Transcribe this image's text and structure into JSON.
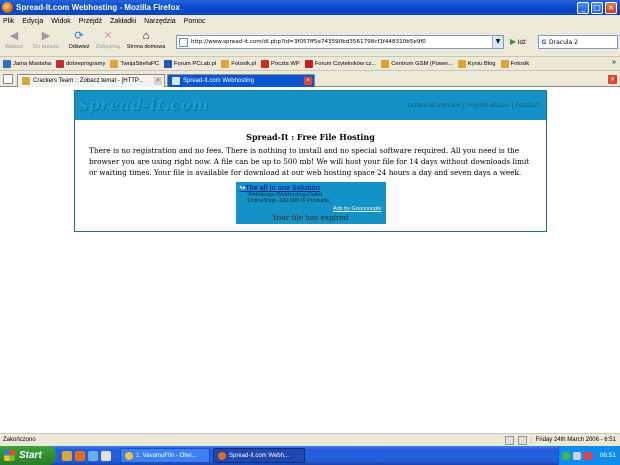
{
  "window": {
    "title": "Spread-It.com Webhosting - Mozilla Firefox",
    "minimize": "_",
    "maximize": "□",
    "close": "×"
  },
  "menu": [
    "Plik",
    "Edycja",
    "Widok",
    "Przejdź",
    "Zakładki",
    "Narzędzia",
    "Pomoc"
  ],
  "toolbar": {
    "back": "Wstecz",
    "forward": "Do przodu",
    "reload": "Odśwież",
    "stop": "Zatrzymaj",
    "home": "Strona domowa",
    "url": "http://www.spread-it.com/dl.php?id=3f057ff5e743590bd3561798cf1f448310b5e9f0",
    "go": "Idź",
    "search_value": "Dracula 2"
  },
  "bookmarks": [
    {
      "label": "Jama Mastaha",
      "color": "#3a6fc0"
    },
    {
      "label": "dobreprogramy",
      "color": "#c0302a"
    },
    {
      "label": "TwojaStrefaPC",
      "color": "#d9a64a"
    },
    {
      "label": "Forum PCLab.pl",
      "color": "#2457b0"
    },
    {
      "label": "Fotosik.pl",
      "color": "#d8a93a"
    },
    {
      "label": "Poczta WP",
      "color": "#d0281c"
    },
    {
      "label": "Forum Czytelników cz...",
      "color": "#c42020"
    },
    {
      "label": "Centrum GSM (Power...",
      "color": "#d4a62e"
    },
    {
      "label": "Kyniu Blog",
      "color": "#d8a93a"
    },
    {
      "label": "Fotosik",
      "color": "#d8a93a"
    }
  ],
  "bookmarks_more": "»",
  "tabs": [
    {
      "label": "Crackers Team :: Zobacz temat - [HTTP...",
      "active": false
    },
    {
      "label": "Spread-It.com Webhosting",
      "active": true
    }
  ],
  "page": {
    "logo": "spread-it.com",
    "nav": "terms of service | report abuse | contact",
    "heading": "Spread-It : Free File Hosting",
    "description": "There is no registration and no fees. There is nothing to install and no special software required. All you need is the browser you are using right now. A file can be up to 500 mb! We will host your file for 14 days without downloads limit or waiting times. Your file is available for download at our web hosting space 24 hours a day and seven days a week.",
    "ad": {
      "title": "The all in one Solution",
      "line1": "Webdesign-Webhosting-Outlet",
      "line2": "OnlineShop. 430.000 IT-Produkte",
      "by": "Ads by Goooooogle"
    },
    "expired": "Your file has expired"
  },
  "status": {
    "text": "Zakończono",
    "datetime": "Friday 24th March 2006 - 6:51"
  },
  "taskbar": {
    "start": "Start",
    "tasks": [
      {
        "label": "1. VavamuFfin - Otwi...",
        "active": false
      },
      {
        "label": "Spread-It.com Webh...",
        "active": true
      }
    ],
    "clock": "06:51"
  },
  "colors": {
    "accent": "#1492c6",
    "titlebar": "#0b4fd0"
  }
}
